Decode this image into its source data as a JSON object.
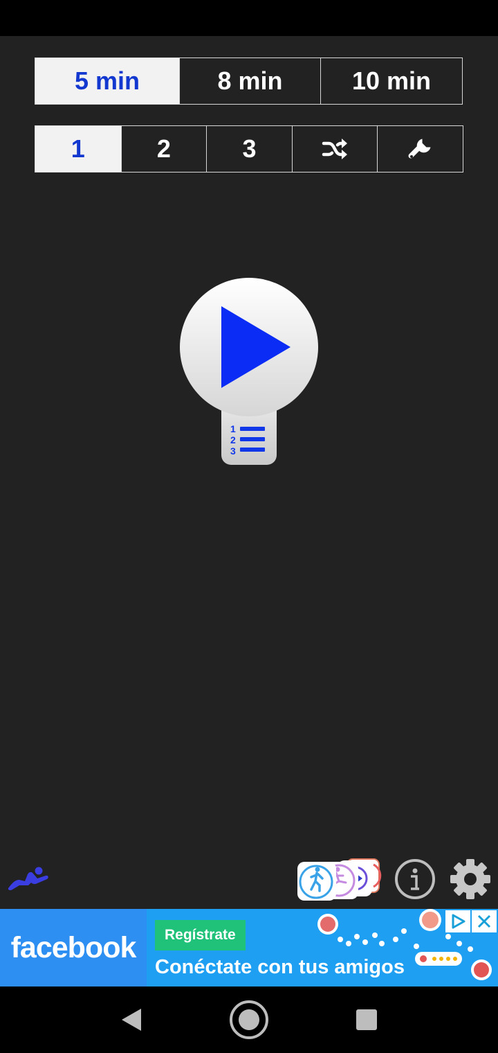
{
  "duration_tabs": [
    {
      "label": "5 min",
      "active": true
    },
    {
      "label": "8 min",
      "active": false
    },
    {
      "label": "10 min",
      "active": false
    }
  ],
  "routine_tabs": [
    {
      "label": "1",
      "active": true
    },
    {
      "label": "2",
      "active": false
    },
    {
      "label": "3",
      "active": false
    },
    {
      "icon": "shuffle-icon"
    },
    {
      "icon": "wrench-icon"
    }
  ],
  "play": {
    "icon": "play-icon",
    "list_icon": "numbered-list-icon"
  },
  "bottom_icons": [
    "situp-man-icon",
    "other-apps-icon",
    "info-icon",
    "gear-icon"
  ],
  "ad": {
    "brand": "facebook",
    "cta": "Regístrate",
    "text": "Conéctate con tus amigos"
  },
  "colors": {
    "background": "#222222",
    "accent": "#1238d0",
    "play_blue": "#0a2cf5",
    "ad_blue": "#1f9ff2",
    "ad_green": "#20c27a"
  }
}
